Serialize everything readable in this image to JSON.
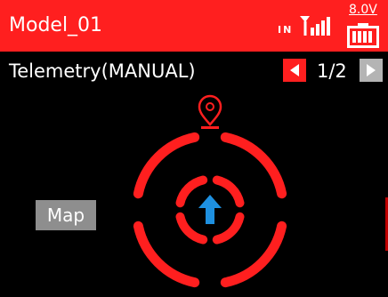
{
  "header": {
    "model_name": "Model_01",
    "signal_label": "IN",
    "signal_icon": "antenna-signal-bars-icon",
    "voltage": "8.0V",
    "battery_icon": "battery-full-icon"
  },
  "telemetry": {
    "title": "Telemetry(MANUAL)",
    "page_indicator": "1/2",
    "prev_icon": "triangle-left-icon",
    "next_icon": "triangle-right-icon"
  },
  "radar": {
    "location_pin_icon": "map-pin-icon",
    "heading_icon": "up-arrow-icon",
    "ring_color": "#ff1f1f",
    "arrow_color": "#1e90e0"
  },
  "map_button": {
    "label": "Map"
  },
  "colors": {
    "header_bg": "#ff1f1f",
    "background": "#000000",
    "next_button_bg": "#b4b4b4",
    "map_button_bg": "#8e8e8e"
  }
}
